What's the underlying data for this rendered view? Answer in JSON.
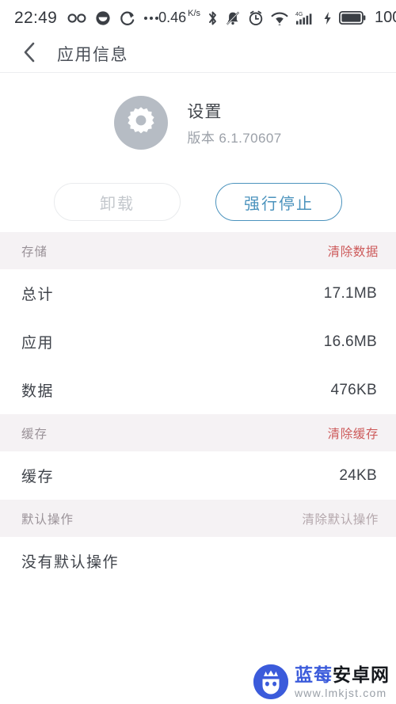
{
  "statusbar": {
    "clock": "22:49",
    "network_speed": "0.46",
    "network_unit_top": "K",
    "network_unit_bottom": "s",
    "battery_level": "100",
    "signal_gen": "4G",
    "icons": [
      "infinity-icon",
      "eye-icon",
      "sync-icon",
      "more-dots-icon",
      "bluetooth-icon",
      "mute-icon",
      "alarm-icon",
      "wifi-icon",
      "cellular-signal-icon",
      "charging-bolt-icon",
      "battery-icon"
    ]
  },
  "header": {
    "back_icon": "chevron-left-icon",
    "title": "应用信息"
  },
  "app": {
    "icon": "gear-icon",
    "name": "设置",
    "version": "版本 6.1.70607"
  },
  "actions": {
    "uninstall_label": "卸载",
    "force_stop_label": "强行停止"
  },
  "sections": [
    {
      "title": "存储",
      "action": "清除数据",
      "action_muted": false,
      "rows": [
        {
          "label": "总计",
          "value": "17.1MB"
        },
        {
          "label": "应用",
          "value": "16.6MB"
        },
        {
          "label": "数据",
          "value": "476KB"
        }
      ]
    },
    {
      "title": "缓存",
      "action": "清除缓存",
      "action_muted": false,
      "rows": [
        {
          "label": "缓存",
          "value": "24KB"
        }
      ]
    },
    {
      "title": "默认操作",
      "action": "清除默认操作",
      "action_muted": true,
      "rows": [
        {
          "label": "没有默认操作",
          "value": ""
        }
      ]
    }
  ],
  "watermark": {
    "brand_blue": "蓝莓",
    "brand_black": "安卓网",
    "url": "www.lmkjst.com"
  },
  "colors": {
    "accent_blue": "#4b93bd",
    "action_red": "#cd5b5b",
    "section_bg": "#f5f2f4",
    "text_primary": "#3f434a",
    "text_muted": "#9ba0a8",
    "watermark_blue": "#3b5bdb"
  }
}
